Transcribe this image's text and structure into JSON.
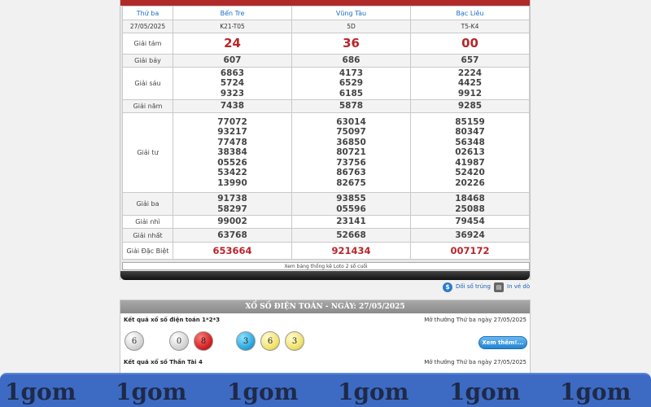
{
  "table": {
    "day": "Thứ ba",
    "provinces": [
      "Bến Tre",
      "Vũng Tàu",
      "Bạc Liêu"
    ],
    "date": "27/05/2025",
    "codes": [
      "K21-T05",
      "5D",
      "T5-K4"
    ],
    "prizes": [
      {
        "label": "Giải tám",
        "values": [
          [
            "24"
          ],
          [
            "36"
          ],
          [
            "00"
          ]
        ]
      },
      {
        "label": "Giải bảy",
        "values": [
          [
            "607"
          ],
          [
            "686"
          ],
          [
            "657"
          ]
        ]
      },
      {
        "label": "Giải sáu",
        "values": [
          [
            "6863",
            "5724",
            "9323"
          ],
          [
            "4173",
            "6529",
            "6185"
          ],
          [
            "2224",
            "4425",
            "9912"
          ]
        ]
      },
      {
        "label": "Giải năm",
        "values": [
          [
            "7438"
          ],
          [
            "5878"
          ],
          [
            "9285"
          ]
        ]
      },
      {
        "label": "Giải tư",
        "values": [
          [
            "77072",
            "93217",
            "77478",
            "38384",
            "05526",
            "53422",
            "13990"
          ],
          [
            "63014",
            "75097",
            "36850",
            "80721",
            "73756",
            "86763",
            "82675"
          ],
          [
            "85159",
            "80347",
            "56348",
            "02613",
            "41987",
            "52420",
            "20226"
          ]
        ]
      },
      {
        "label": "Giải ba",
        "values": [
          [
            "91738",
            "58297"
          ],
          [
            "93855",
            "05596"
          ],
          [
            "18468",
            "25088"
          ]
        ]
      },
      {
        "label": "Giải nhì",
        "values": [
          [
            "99002"
          ],
          [
            "23141"
          ],
          [
            "79454"
          ]
        ]
      },
      {
        "label": "Giải nhất",
        "values": [
          [
            "63768"
          ],
          [
            "52668"
          ],
          [
            "36924"
          ]
        ]
      },
      {
        "label": "Giải Đặc Biệt",
        "values": [
          [
            "653664"
          ],
          [
            "921434"
          ],
          [
            "007172"
          ]
        ]
      }
    ],
    "stats_link": "Xem bảng thống kê Loto 2 số cuối"
  },
  "tools": {
    "compare": "Dối số trúng",
    "print": "In vé dò"
  },
  "dien_toan": {
    "header": "XỔ SỐ ĐIỆN TOÁN - NGÀY: 27/05/2025",
    "game1_title": "Kết quả xổ số điện toán 1*2*3",
    "game1_date": "Mở thưởng Thứ ba ngày  27/05/2025",
    "balls": [
      {
        "value": "6",
        "color": "white"
      },
      {
        "value": "0",
        "color": "white"
      },
      {
        "value": "8",
        "color": "red"
      },
      {
        "value": "3",
        "color": "blue"
      },
      {
        "value": "6",
        "color": "yellow"
      },
      {
        "value": "3",
        "color": "yellow"
      }
    ],
    "more_button": "Xem thêm!...",
    "game2_title": "Kết quả xổ số Thần Tài 4",
    "game2_date": "Mở thưởng Thứ ba ngày 27/05/2025"
  },
  "watermark": [
    "1gom",
    "1gom",
    "1gom",
    "1gom",
    "1gom",
    "1gom"
  ],
  "colors": {
    "accent_red": "#b8262a",
    "link_blue": "#1a6fc4",
    "watermark_bg": "#3d6bc3"
  }
}
